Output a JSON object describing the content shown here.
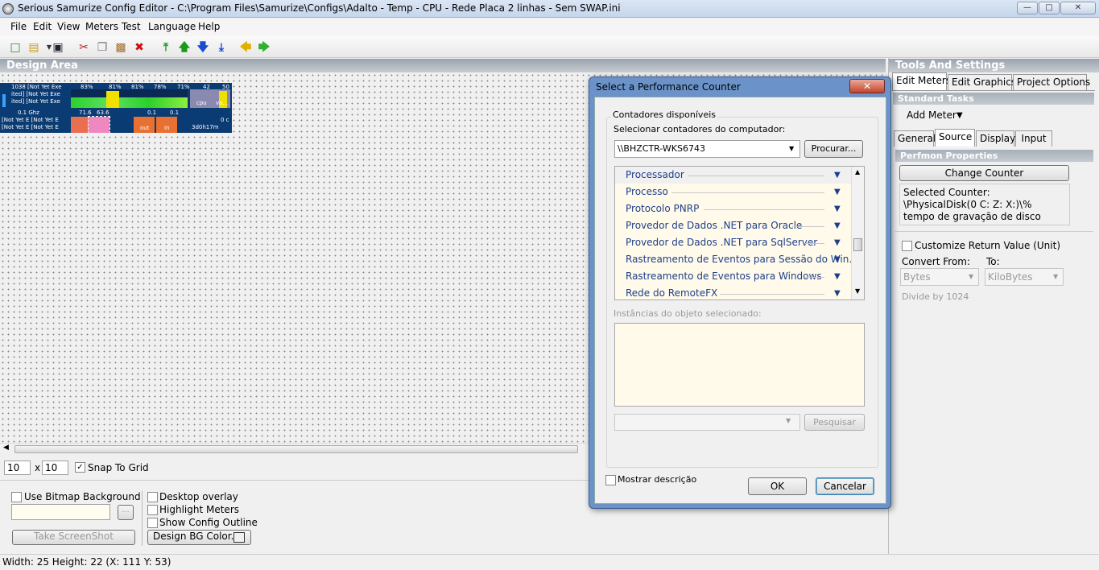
{
  "window": {
    "title": "Serious Samurize Config Editor - C:\\Program Files\\Samurize\\Configs\\Adalto - Temp - CPU - Rede Placa 2 linhas - Sem SWAP.ini"
  },
  "menu": [
    "File",
    "Edit",
    "View",
    "Meters",
    "Test",
    "Language",
    "Help"
  ],
  "toolbar_icons": [
    "new-icon",
    "open-icon",
    "save-icon",
    "cut-icon",
    "copy-icon",
    "paste-icon",
    "delete-icon",
    "bring-to-front-icon",
    "move-up-icon",
    "move-down-icon",
    "send-to-back-icon",
    "undo-icon",
    "redo-icon"
  ],
  "design_area": {
    "title": "Design Area",
    "skin": {
      "row1_left": [
        "1038 [Not Yet Exe",
        "ited] [Not Yet Exe",
        "ited] [Not Yet Exe"
      ],
      "row1_pcts": [
        "83%",
        "81%",
        "81%",
        "78%",
        "71%",
        "42",
        "50"
      ],
      "mini_labels": [
        "cpu",
        "va..."
      ],
      "row2_left": "0.1 Ghz",
      "row2_vals": [
        "71.6",
        "63.6",
        "0.1",
        "0.1"
      ],
      "row3_left": [
        "[Not Yet E [Not Yet E",
        "[Not Yet E [Not Yet E"
      ],
      "row3_labels": [
        "out",
        "in"
      ],
      "uptime": "3d0h17m",
      "oc": "0 c"
    }
  },
  "grid": {
    "x": "10",
    "y": "10",
    "separator": "x",
    "snap_label": "Snap To Grid",
    "snap_checked": true
  },
  "bottom": {
    "use_bitmap": "Use Bitmap Background",
    "browse": "...",
    "screenshot": "Take ScreenShot",
    "desktop_overlay": "Desktop overlay",
    "highlight": "Highlight Meters",
    "outline": "Show Config Outline",
    "bg_color": "Design BG Color..."
  },
  "status": "Width: 25  Height: 22  (X: 111  Y: 53)",
  "right": {
    "title": "Tools And Settings",
    "tabs": [
      "Edit Meters",
      "Edit Graphics",
      "Project Options"
    ],
    "standard_tasks": "Standard Tasks",
    "add_meter": "Add Meter",
    "subtabs": [
      "General",
      "Source",
      "Display",
      "Input"
    ],
    "perfmon": "Perfmon Properties",
    "change_counter": "Change Counter",
    "selected_counter": "Selected Counter:\n\\PhysicalDisk(0 C: Z: X:)\\% tempo de gravação de disco",
    "customize": "Customize Return Value (Unit)",
    "convert_from": "Convert From:",
    "to": "To:",
    "from_value": "Bytes",
    "to_value": "KiloBytes",
    "divide": "Divide by 1024"
  },
  "dialog": {
    "title": "Select a Performance Counter",
    "group": "Contadores disponíveis",
    "select_label": "Selecionar contadores do computador:",
    "computer": "\\\\BHZCTR-WKS6743",
    "browse": "Procurar...",
    "counters": [
      "Processador",
      "Processo",
      "Protocolo PNRP",
      "Provedor de Dados .NET para Oracle",
      "Provedor de Dados .NET para SqlServer",
      "Rastreamento de Eventos para Sessão do Win...",
      "Rastreamento de Eventos para Windows",
      "Rede do RemoteFX"
    ],
    "instances_label": "Instâncias do objeto selecionado:",
    "search": "Pesquisar",
    "show_desc": "Mostrar descrição",
    "ok": "OK",
    "cancel": "Cancelar"
  }
}
